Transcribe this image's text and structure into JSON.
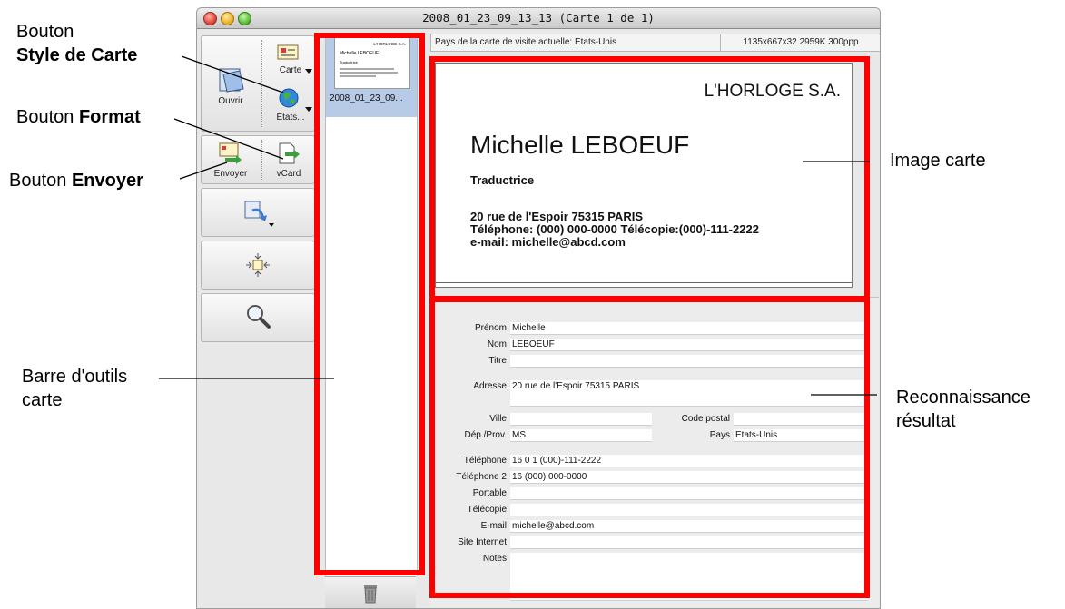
{
  "window": {
    "title": "2008_01_23_09_13_13 (Carte 1 de 1)"
  },
  "toolbar": {
    "open_label": "Ouvrir",
    "card_style_label": "Carte",
    "format_label": "Etats...",
    "send_label": "Envoyer",
    "vcard_label": "vCard"
  },
  "thumbnail": {
    "label": "2008_01_23_09...",
    "mini_company": "L'HORLOGE S.A.",
    "mini_name": "Michelle LEBOEUF",
    "mini_title": "Traductrice"
  },
  "status": {
    "country_text": "Pays de la carte de visite actuelle: Etats-Unis",
    "image_info": "1135x667x32  2959K  300ppp"
  },
  "card": {
    "company": "L'HORLOGE S.A.",
    "name": "Michelle LEBOEUF",
    "title": "Traductrice",
    "address": "20 rue de l'Espoir 75315 PARIS",
    "phones": "Téléphone: (000) 000-0000   Télécopie:(000)-111-2222",
    "email": "e-mail: michelle@abcd.com"
  },
  "form": {
    "prenom_label": "Prénom",
    "prenom_value": "Michelle",
    "nom_label": "Nom",
    "nom_value": "LEBOEUF",
    "titre_label": "Titre",
    "titre_value": "",
    "adresse_label": "Adresse",
    "adresse_value": "20 rue de l'Espoir 75315 PARIS",
    "ville_label": "Ville",
    "ville_value": "",
    "codepostal_label": "Code postal",
    "codepostal_value": "",
    "depprov_label": "Dép./Prov.",
    "depprov_value": "MS",
    "pays_label": "Pays",
    "pays_value": "Etats-Unis",
    "tel_label": "Téléphone",
    "tel_value": "16 0 1 (000)-111-2222",
    "tel2_label": "Téléphone 2",
    "tel2_value": "16 (000) 000-0000",
    "portable_label": "Portable",
    "portable_value": "",
    "telecopie_label": "Télécopie",
    "telecopie_value": "",
    "email_label": "E-mail",
    "email_value": "michelle@abcd.com",
    "site_label": "Site Internet",
    "site_value": "",
    "notes_label": "Notes",
    "notes_value": ""
  },
  "annotations": {
    "style_line1": "Bouton",
    "style_line2": "Style de Carte",
    "format_prefix": "Bouton ",
    "format_bold": "Format",
    "send_prefix": "Bouton ",
    "send_bold": "Envoyer",
    "toolbar_line1": "Barre d'outils",
    "toolbar_line2": "carte",
    "image_label": "Image carte",
    "result_line1": "Reconnaissance",
    "result_line2": "résultat"
  },
  "colors": {
    "highlight": "#ff0000",
    "selection": "#b8cbe6"
  }
}
